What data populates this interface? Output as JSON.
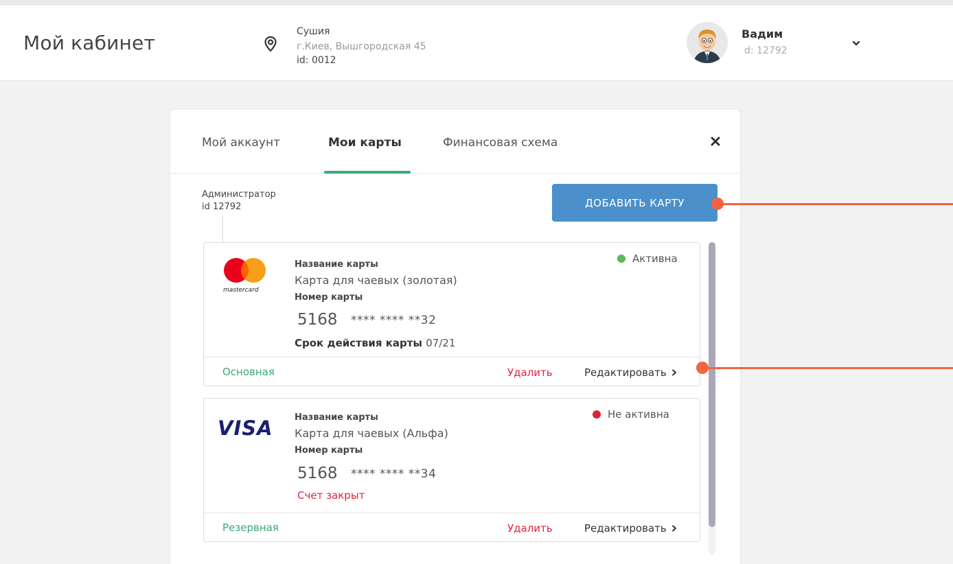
{
  "header": {
    "title": "Мой кабинет",
    "location": {
      "name": "Сушия",
      "address": "г.Киев, Вышгородская 45",
      "id": "id: 0012"
    },
    "user": {
      "name": "Вадим",
      "id": "d: 12792"
    }
  },
  "tabs": [
    {
      "label": "Мой аккаунт"
    },
    {
      "label": "Мои карты",
      "active": true
    },
    {
      "label": "Финансовая схема"
    }
  ],
  "account": {
    "role": "Администратор",
    "id": "id 12792"
  },
  "add_button_label": "ДОБАВИТЬ КАРТУ",
  "cards": [
    {
      "brand_icon": "mastercard-logo",
      "brand_text": "mastercard",
      "name_label": "Название карты",
      "name": "Карта для чаевых (золотая)",
      "number_label": "Номер карты",
      "number_first": "5168",
      "number_rest": "**** **** **32",
      "expiry_label": "Срок действия карты",
      "expiry": "07/21",
      "status": "Активна",
      "status_color": "#5cb85c",
      "type": "Основная",
      "delete_label": "Удалить",
      "edit_label": "Редактировать"
    },
    {
      "brand_icon": "visa-logo",
      "brand_text": "VISA",
      "name_label": "Название карты",
      "name": "Карта для чаевых (Альфа)",
      "number_label": "Номер карты",
      "number_first": "5168",
      "number_rest": "**** **** **34",
      "closed_note": "Счет закрыт",
      "status": "Не активна",
      "status_color": "#e0223c",
      "type": "Резервная",
      "delete_label": "Удалить",
      "edit_label": "Редактировать"
    }
  ],
  "colors": {
    "accent_green": "#3aa876",
    "button_blue": "#4b8fcb",
    "danger_red": "#e0223c",
    "annotation": "#f2643f"
  }
}
